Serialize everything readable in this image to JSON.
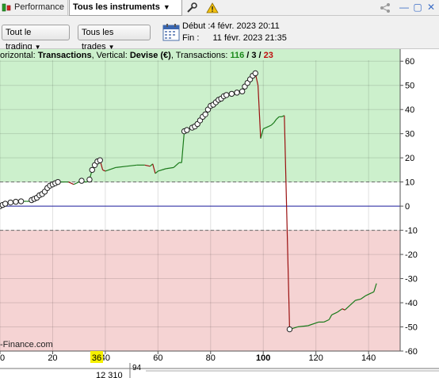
{
  "tabs": {
    "performance_label": "Performance",
    "instruments_label": "Tous les instruments"
  },
  "toolbar": {
    "trading_filter": "Tout le trading",
    "trades_filter": "Tous les trades",
    "start_label": "Début :",
    "start_value": "4 févr. 2023 20:11",
    "end_label": "Fin :",
    "end_value": "11 févr. 2023 21:35"
  },
  "header": {
    "prefix": "orizontal: ",
    "horizontal": "Transactions",
    "sep1": ", Vertical: ",
    "vertical": "Devise (€)",
    "sep2": ", Transactions: ",
    "total": "116",
    "slash1": " / ",
    "neutral": "3",
    "slash2": " / ",
    "losing": "23"
  },
  "watermark": "-Finance.com",
  "cursor": {
    "x_label": "36",
    "sub_label_left": "12 310",
    "sub_label_right": "94"
  },
  "colors": {
    "profit_zone": "#ccf0cc",
    "loss_zone": "#f5d3d3",
    "gain_line": "#1a7a1a",
    "loss_line": "#9a1010",
    "zero_line": "#2020a0",
    "total_green": "#1a8a1a",
    "losing_red": "#c01010",
    "cursor_label_bg": "#f5f000"
  },
  "chart_data": {
    "type": "line",
    "xlabel": "",
    "ylabel": "",
    "xlim": [
      0,
      152
    ],
    "ylim": [
      -60,
      65
    ],
    "x_ticks": [
      0,
      20,
      40,
      60,
      80,
      100,
      120,
      140
    ],
    "y_ticks": [
      60,
      50,
      40,
      30,
      20,
      10,
      0,
      -10,
      -20,
      -30,
      -40,
      -50,
      -60
    ],
    "zones": {
      "profit_above": 10,
      "loss_below": -10
    },
    "series": [
      {
        "values": [
          [
            0,
            0
          ],
          [
            1,
            0.5
          ],
          [
            2,
            1
          ],
          [
            3,
            1
          ],
          [
            4,
            1.5
          ],
          [
            5,
            1.5
          ],
          [
            6,
            1.8
          ],
          [
            7,
            1.8
          ],
          [
            8,
            2
          ],
          [
            9,
            2
          ],
          [
            10,
            2
          ],
          [
            11,
            2
          ],
          [
            12,
            2.5
          ],
          [
            13,
            3
          ],
          [
            14,
            3.5
          ],
          [
            15,
            4.5
          ],
          [
            16,
            5
          ],
          [
            17,
            6
          ],
          [
            18,
            7.5
          ],
          [
            19,
            8.5
          ],
          [
            20,
            9
          ],
          [
            21,
            9.5
          ],
          [
            22,
            10
          ],
          [
            23,
            10
          ],
          [
            24,
            10
          ],
          [
            25,
            10
          ],
          [
            26,
            10
          ],
          [
            27,
            9.5
          ],
          [
            28,
            9
          ],
          [
            29,
            9.5
          ],
          [
            30,
            10
          ],
          [
            31,
            10.5
          ],
          [
            32,
            10
          ],
          [
            33,
            10
          ],
          [
            34,
            11
          ],
          [
            35,
            15
          ],
          [
            36,
            17
          ],
          [
            37,
            18.5
          ],
          [
            38,
            19
          ],
          [
            39,
            15
          ],
          [
            40,
            14.5
          ],
          [
            44,
            16
          ],
          [
            48,
            16.5
          ],
          [
            52,
            17
          ],
          [
            55,
            17
          ],
          [
            57,
            16.5
          ],
          [
            58,
            17.5
          ],
          [
            59,
            13.5
          ],
          [
            60,
            14.5
          ],
          [
            63,
            15.5
          ],
          [
            66,
            16
          ],
          [
            68,
            18
          ],
          [
            69,
            18
          ],
          [
            70,
            31
          ],
          [
            71,
            31.5
          ],
          [
            73,
            32.5
          ],
          [
            74,
            33
          ],
          [
            75,
            34
          ],
          [
            76,
            35.5
          ],
          [
            77,
            37
          ],
          [
            78,
            38
          ],
          [
            79,
            40
          ],
          [
            80,
            41.5
          ],
          [
            81,
            42
          ],
          [
            82,
            43
          ],
          [
            83,
            44
          ],
          [
            84,
            44.5
          ],
          [
            85,
            45.5
          ],
          [
            86,
            46
          ],
          [
            87,
            46
          ],
          [
            88,
            46.5
          ],
          [
            89,
            46.5
          ],
          [
            90,
            47
          ],
          [
            91,
            47
          ],
          [
            92,
            47.5
          ],
          [
            93,
            49.5
          ],
          [
            94,
            51
          ],
          [
            95,
            52.5
          ],
          [
            96,
            54
          ],
          [
            97,
            55
          ],
          [
            98,
            50
          ],
          [
            99,
            28
          ],
          [
            100,
            32
          ],
          [
            101,
            32.5
          ],
          [
            102,
            33
          ],
          [
            103,
            33.5
          ],
          [
            104,
            34.5
          ],
          [
            105,
            36
          ],
          [
            106,
            37
          ],
          [
            107,
            37
          ],
          [
            108,
            37.5
          ],
          [
            110,
            -51
          ],
          [
            113,
            -50
          ],
          [
            117,
            -49.5
          ],
          [
            121,
            -48
          ],
          [
            123,
            -48
          ],
          [
            125,
            -47
          ],
          [
            126,
            -45
          ],
          [
            128,
            -44
          ],
          [
            130,
            -42.5
          ],
          [
            131,
            -43
          ],
          [
            133,
            -41
          ],
          [
            135,
            -39
          ],
          [
            137,
            -38.5
          ],
          [
            139,
            -37
          ],
          [
            141,
            -36
          ],
          [
            142,
            -35.5
          ],
          [
            143,
            -32
          ]
        ]
      }
    ]
  }
}
